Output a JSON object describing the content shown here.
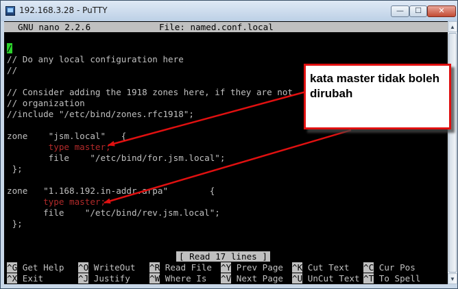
{
  "window": {
    "title": "192.168.3.28 - PuTTY",
    "buttons": {
      "minimize": "—",
      "maximize": "☐",
      "close": "✕"
    }
  },
  "nano": {
    "header_left": "GNU nano 2.2.6",
    "header_center": "File: named.conf.local",
    "cursor_char": "/",
    "lines": [
      "/",
      "// Do any local configuration here",
      "//",
      "",
      "// Consider adding the 1918 zones here, if they are not",
      "// organization",
      "//include \"/etc/bind/zones.rfc1918\";",
      "",
      "zone    \"jsm.local\"   {",
      "        type master;",
      "        file    \"/etc/bind/for.jsm.local\";",
      " };",
      "",
      "zone   \"1.168.192.in-addr.arpa\"        {",
      "       type master;",
      "       file    \"/etc/bind/rev.jsm.local\";",
      " };"
    ],
    "status_message": "[ Read 17 lines ]",
    "shortcuts_row1": [
      {
        "key": "^G",
        "label": "Get Help"
      },
      {
        "key": "^O",
        "label": "WriteOut"
      },
      {
        "key": "^R",
        "label": "Read File"
      },
      {
        "key": "^Y",
        "label": "Prev Page"
      },
      {
        "key": "^K",
        "label": "Cut Text"
      },
      {
        "key": "^C",
        "label": "Cur Pos"
      }
    ],
    "shortcuts_row2": [
      {
        "key": "^X",
        "label": "Exit"
      },
      {
        "key": "^J",
        "label": "Justify"
      },
      {
        "key": "^W",
        "label": "Where Is"
      },
      {
        "key": "^V",
        "label": "Next Page"
      },
      {
        "key": "^U",
        "label": "UnCut Text"
      },
      {
        "key": "^T",
        "label": "To Spell"
      }
    ]
  },
  "annotation": {
    "text": "kata master tidak boleh dirubah",
    "border_color": "#e01010",
    "arrow_color": "#e01010"
  },
  "colors": {
    "terminal_bg": "#000000",
    "terminal_fg": "#c0c0c0",
    "highlight_red": "#b22a2a",
    "cursor": "#2bd22b"
  }
}
